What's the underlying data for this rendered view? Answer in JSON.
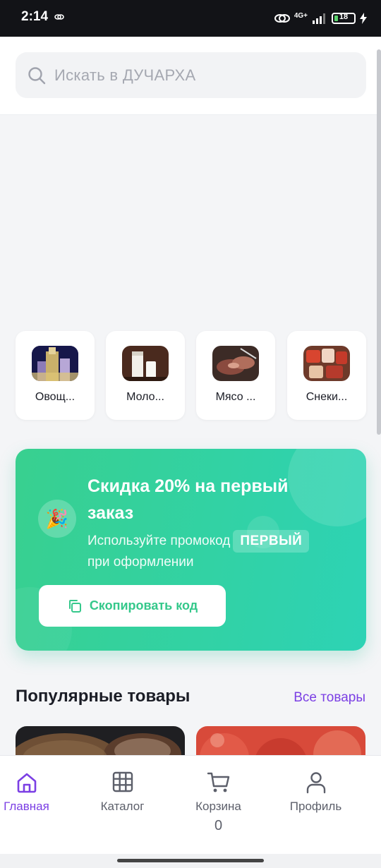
{
  "status": {
    "time": "2:14",
    "network": "4G+",
    "battery": "18",
    "battery_level": 0.18
  },
  "search": {
    "placeholder": "Искать в ДУЧАРХА"
  },
  "categories": [
    {
      "label": "Овощ...",
      "icon": "city-photo"
    },
    {
      "label": "Моло...",
      "icon": "milk-photo"
    },
    {
      "label": "Мясо ...",
      "icon": "meat-photo"
    },
    {
      "label": "Снеки...",
      "icon": "snacks-photo"
    }
  ],
  "promo": {
    "title": "Скидка 20% на первый заказ",
    "desc_before": "Используйте промокод",
    "code": "ПЕРВЫЙ",
    "desc_after": "при оформлении",
    "button": "Скопировать код",
    "icon": "party-popper-icon",
    "colors": {
      "start": "#38d08f",
      "end": "#2dd3b5"
    }
  },
  "popular": {
    "title": "Популярные товары",
    "all_link": "Все товары"
  },
  "nav": {
    "items": [
      {
        "label": "Главная",
        "icon": "home-icon",
        "active": true
      },
      {
        "label": "Каталог",
        "icon": "grid-icon"
      },
      {
        "label": "Корзина",
        "icon": "cart-icon",
        "count": "0"
      },
      {
        "label": "Профиль",
        "icon": "user-icon"
      }
    ]
  },
  "colors": {
    "accent": "#7b3fe4",
    "promo_text": "#35c88b"
  }
}
